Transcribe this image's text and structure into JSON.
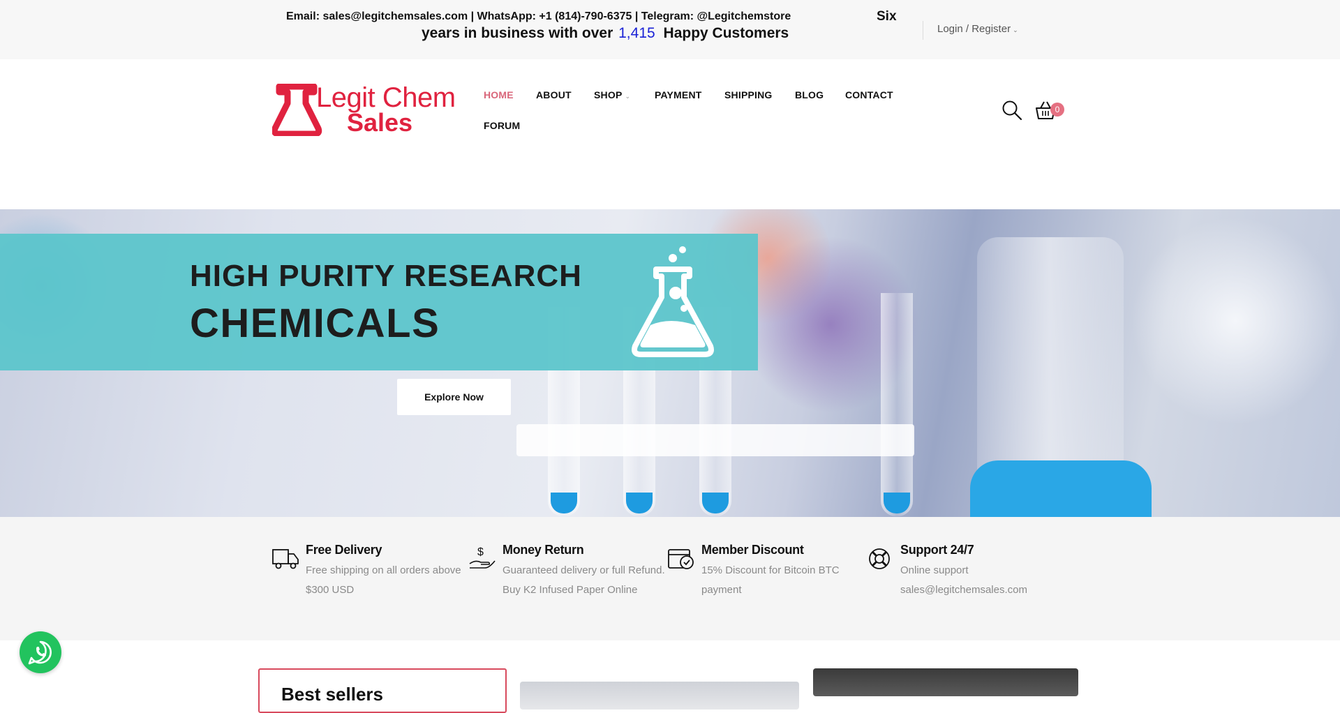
{
  "topbar": {
    "contact": "Email: sales@legitchemsales.com | WhatsApp: +1 (814)-790-6375 | Telegram: @Legitchemstore",
    "six": "Six",
    "line2_prefix": "years in business with over",
    "customer_count": "1,415",
    "line2_suffix": "Happy Customers",
    "login": "Login / Register"
  },
  "logo": {
    "line1": "Legit Chem",
    "line2": "Sales"
  },
  "nav": {
    "items": [
      "HOME",
      "ABOUT",
      "SHOP",
      "PAYMENT",
      "SHIPPING",
      "BLOG",
      "CONTACT",
      "FORUM"
    ],
    "active": "HOME"
  },
  "header": {
    "cart_count": "0",
    "icons": [
      "search-icon",
      "cart-icon"
    ]
  },
  "hero": {
    "line1": "HIGH PURITY RESEARCH",
    "line2": "CHEMICALS",
    "button": "Explore Now"
  },
  "features": [
    {
      "icon": "truck-icon",
      "title": "Free Delivery",
      "desc": "Free shipping on all orders above $300 USD"
    },
    {
      "icon": "money-hand-icon",
      "title": "Money Return",
      "desc": "Guaranteed delivery or full Refund. Buy K2 Infused Paper Online"
    },
    {
      "icon": "discount-card-icon",
      "title": "Member Discount",
      "desc": "15% Discount for Bitcoin BTC payment"
    },
    {
      "icon": "lifebuoy-icon",
      "title": "Support 24/7",
      "desc": "Online support sales@legitchemsales.com"
    }
  ],
  "bestsellers": {
    "title": "Best sellers"
  },
  "colors": {
    "brand_red": "#e0223f",
    "nav_active": "#d9667a",
    "hero_band": "#5cc5cb",
    "count_blue": "#1a22d6",
    "whatsapp_green": "#22c35e"
  }
}
